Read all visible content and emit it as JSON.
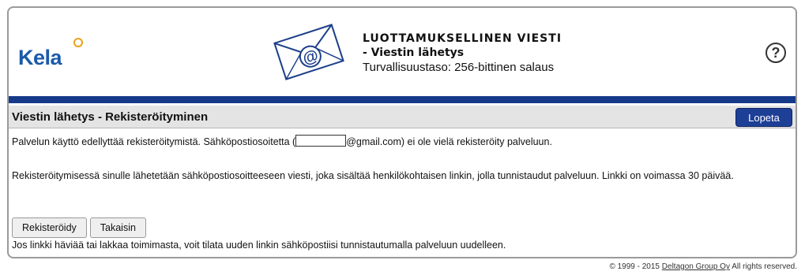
{
  "header": {
    "logo_text": "Kela",
    "title_line1": "LUOTTAMUKSELLINEN VIESTI",
    "title_line2": "- Viestin lähetys",
    "title_line3": "Turvallisuustaso: 256-bittinen salaus",
    "help_icon": "?"
  },
  "section": {
    "title": "Viestin lähetys - Rekisteröityminen",
    "logout_label": "Lopeta"
  },
  "content": {
    "line1_prefix": "Palvelun käyttö edellyttää rekisteröitymistä. Sähköpostiosoitetta (",
    "line1_suffix": "@gmail.com) ei ole vielä rekisteröity palveluun.",
    "line2": "Rekisteröitymisessä sinulle lähetetään sähköpostiosoitteeseen viesti, joka sisältää henkilökohtaisen linkin, jolla tunnistaudut palveluun. Linkki on voimassa 30 päivää.",
    "line3": "Jos linkki häviää tai lakkaa toimimasta, voit tilata uuden linkin sähköpostiisi tunnistautumalla palveluun uudelleen."
  },
  "actions": {
    "register_label": "Rekisteröidy",
    "back_label": "Takaisin"
  },
  "footer": {
    "copyright_prefix": "© 1999 - 2015",
    "company_link": "Deltagon Group Oy",
    "rights": "All rights reserved."
  },
  "colors": {
    "brand_blue": "#1c5aa8",
    "bar_blue": "#163a8a",
    "logout_button": "#1d3f96",
    "logo_accent": "#e8a21a"
  },
  "icons": {
    "logo": "kela-logo",
    "envelope": "envelope-at-icon",
    "help": "help-icon"
  }
}
